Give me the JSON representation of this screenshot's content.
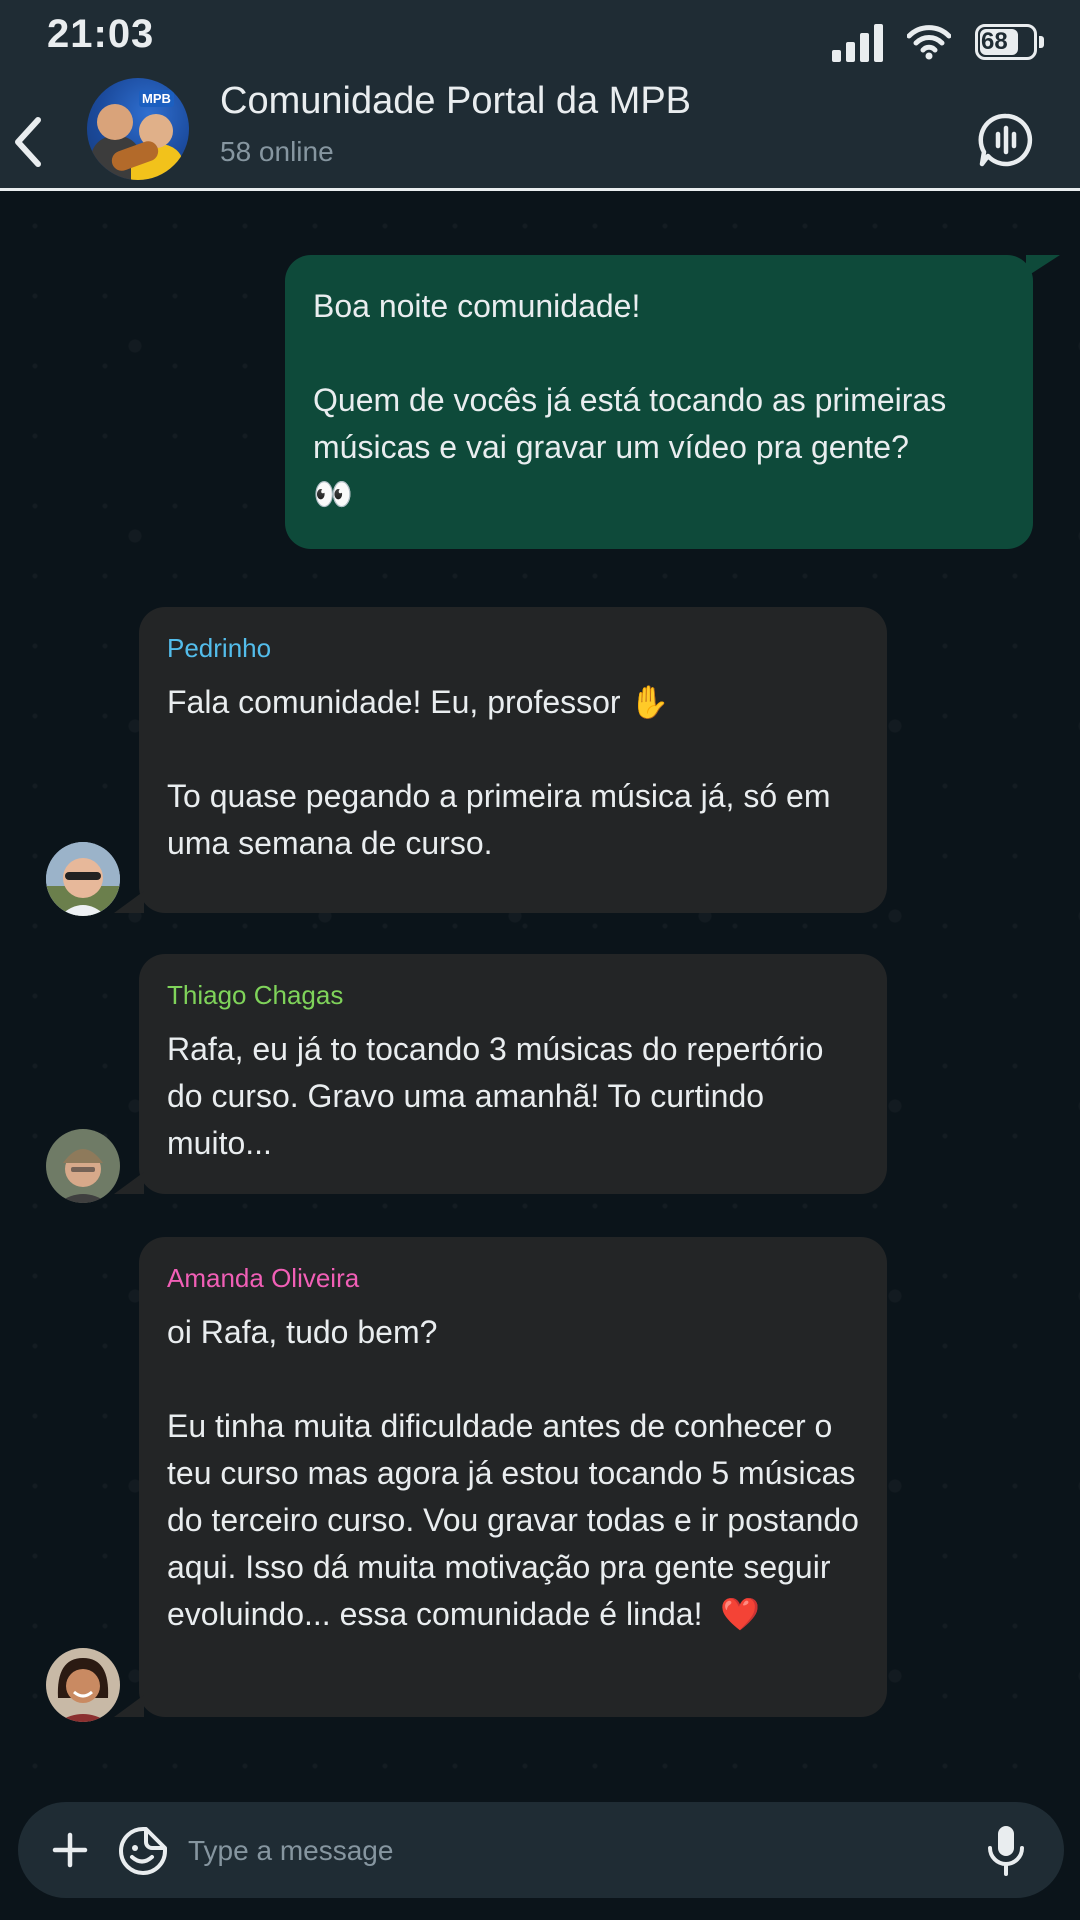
{
  "status_bar": {
    "time": "21:03",
    "battery": "68",
    "battery_level": 0.68,
    "icons": [
      "signal-icon",
      "wifi-icon",
      "battery-icon"
    ]
  },
  "header": {
    "title": "Comunidade Portal da MPB",
    "subtitle": "58 online",
    "avatar_logo": "MPB",
    "icons": [
      "back-icon",
      "group-avatar",
      "voice-chat-icon"
    ]
  },
  "messages": [
    {
      "direction": "outgoing",
      "text": "Boa noite comunidade!\n\nQuem de vocês já está tocando as primeiras músicas e vai gravar um vídeo pra gente?\n👀"
    },
    {
      "direction": "incoming",
      "sender": "Pedrinho",
      "sender_color": "#53bdeb",
      "text": "Fala comunidade! Eu, professor ✋\n\nTo quase pegando a primeira música já, só em uma semana de curso."
    },
    {
      "direction": "incoming",
      "sender": "Thiago Chagas",
      "sender_color": "#7fd35a",
      "text": "Rafa, eu já to tocando 3 músicas do repertório do curso. Gravo uma amanhã! To curtindo muito..."
    },
    {
      "direction": "incoming",
      "sender": "Amanda Oliveira",
      "sender_color": "#f15fb6",
      "text": "oi Rafa, tudo bem?\n\nEu tinha muita dificuldade antes de conhecer o teu curso mas agora já estou tocando 5 músicas do terceiro curso. Vou gravar todas e ir postando aqui. Isso dá muita motivação pra gente seguir evoluindo... essa comunidade é linda!  ❤️"
    }
  ],
  "input": {
    "placeholder": "Type a message",
    "value": "",
    "icons": [
      "plus-icon",
      "sticker-icon",
      "microphone-icon"
    ]
  },
  "colors": {
    "header_bg": "#1f2c34",
    "chat_bg": "#0b141a",
    "outgoing_bubble": "#0e4a3a",
    "incoming_bubble": "#232526"
  }
}
